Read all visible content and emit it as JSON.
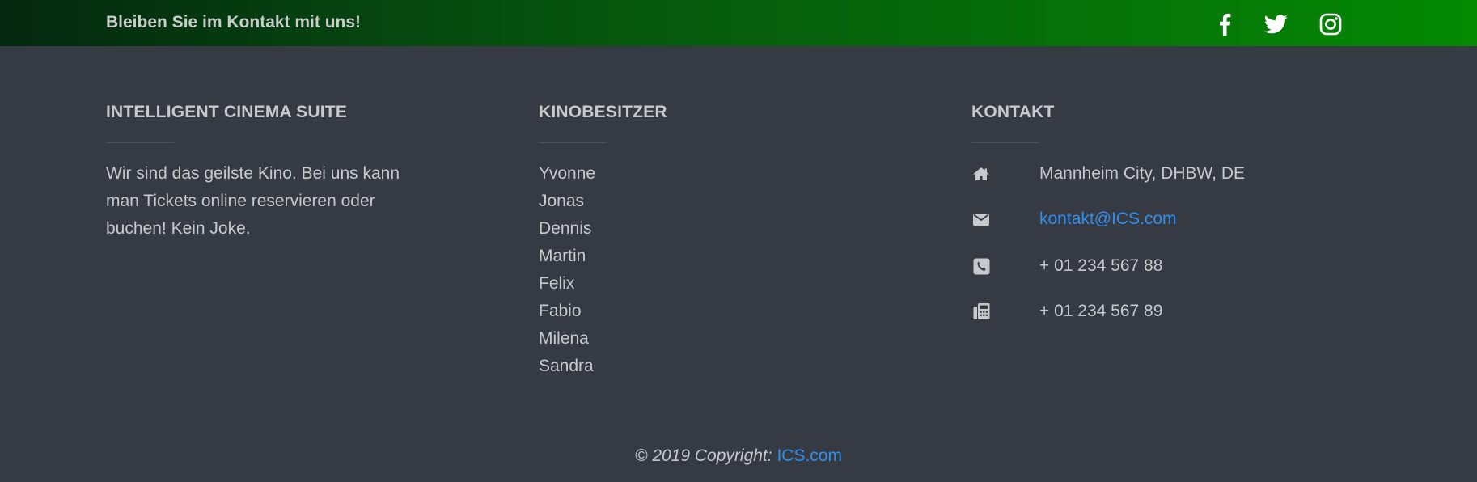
{
  "topbar": {
    "tagline": "Bleiben Sie im Kontakt mit uns!",
    "social": [
      {
        "name": "facebook-icon"
      },
      {
        "name": "twitter-icon"
      },
      {
        "name": "instagram-icon"
      }
    ]
  },
  "columns": {
    "about": {
      "title": "INTELLIGENT CINEMA SUITE",
      "text": "Wir sind das geilste Kino. Bei uns kann man Tickets online reservieren oder buchen! Kein Joke."
    },
    "owners": {
      "title": "KINOBESITZER",
      "items": [
        "Yvonne",
        "Jonas",
        "Dennis",
        "Martin",
        "Felix",
        "Fabio",
        "Milena",
        "Sandra"
      ]
    },
    "contact": {
      "title": "KONTAKT",
      "address": "Mannheim City, DHBW, DE",
      "email": "kontakt@ICS.com",
      "phone": "+ 01 234 567 88",
      "fax": "+ 01 234 567 89"
    }
  },
  "footer": {
    "copyright_prefix": "© 2019 Copyright:",
    "brand": "ICS.com"
  },
  "colors": {
    "background": "#363a42",
    "link": "#2f8fef",
    "topbar_start": "#04270f",
    "topbar_end": "#048a03"
  }
}
